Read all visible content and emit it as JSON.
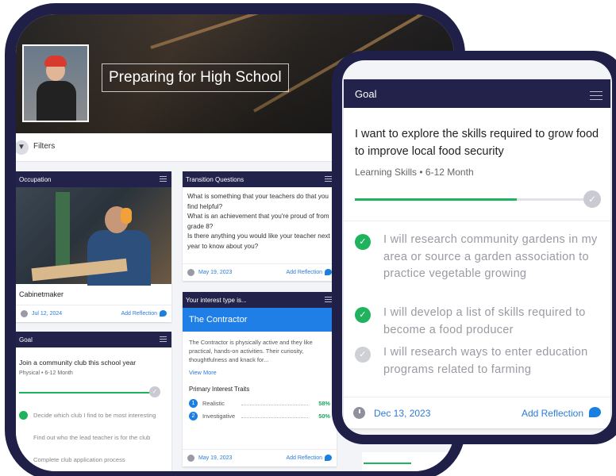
{
  "hero": {
    "title": "Preparing for High School"
  },
  "filters": {
    "label": "Filters"
  },
  "occupation_card": {
    "header": "Occupation",
    "name": "Cabinetmaker",
    "date": "Jul 12, 2024",
    "add_reflection": "Add Reflection"
  },
  "transition_card": {
    "header": "Transition Questions",
    "questions": [
      "What is something that your teachers do that you find helpful?",
      "What is an achievement that you're proud of from grade 8?",
      "Is there anything you would like your teacher next year to know about you?"
    ],
    "date": "May 19, 2023",
    "add_reflection": "Add Reflection"
  },
  "interest_card": {
    "header": "Your interest type is...",
    "type": "The Contractor",
    "description": "The Contractor is physically active and they like practical, hands-on activities. Their curiosity, thoughtfulness and knack for...",
    "view_more": "View More",
    "traits_title": "Primary Interest Traits",
    "traits": [
      {
        "num": "1",
        "label": "Realistic",
        "pct": "58%"
      },
      {
        "num": "2",
        "label": "Investigative",
        "pct": "50%"
      }
    ],
    "date": "May 19, 2023",
    "add_reflection": "Add Reflection"
  },
  "small_goal_card": {
    "header": "Goal",
    "title": "Join a community club this school year",
    "subtitle": "Physical • 6-12 Month",
    "progress": 0.97,
    "items": [
      "Decide which club I find to be most interesting",
      "Find out who the lead teacher is for the club",
      "Complete club application process"
    ]
  },
  "goal_card": {
    "header": "Goal",
    "title": "I want to explore the skills required to grow food to improve local food security",
    "subtitle": "Learning Skills • 6-12 Month",
    "progress": 0.68,
    "items": [
      {
        "text": "I will research community gardens in my area or source a garden association to practice vegetable growing",
        "done": true
      },
      {
        "text": "I will develop a list of skills required to become a food producer",
        "done": true
      },
      {
        "text": "I will research ways to enter education programs related to farming",
        "done": false
      }
    ],
    "date": "Dec 13, 2023",
    "add_reflection": "Add Reflection"
  },
  "colors": {
    "navy": "#1f1f47",
    "header": "#22224a",
    "accent_blue": "#1a7fe0",
    "success_green": "#1fb35d"
  }
}
